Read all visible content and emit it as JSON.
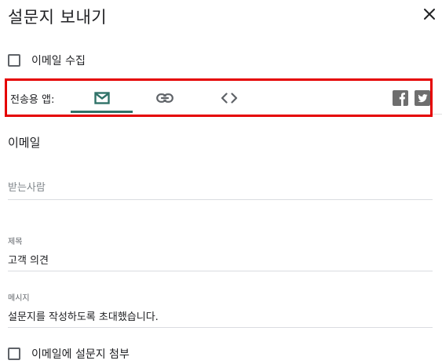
{
  "dialog": {
    "title": "설문지 보내기",
    "close_icon": "close-icon"
  },
  "collect_email": {
    "label": "이메일 수집",
    "checked": false
  },
  "send_via": {
    "label": "전송용 앱:",
    "tabs": [
      {
        "icon": "mail-icon",
        "selected": true
      },
      {
        "icon": "link-icon",
        "selected": false
      },
      {
        "icon": "embed-code-icon",
        "selected": false
      }
    ],
    "social": [
      {
        "icon": "facebook-icon"
      },
      {
        "icon": "twitter-icon"
      }
    ],
    "accent_color": "#2f7268",
    "highlight_color": "#e50000"
  },
  "email_form": {
    "heading": "이메일",
    "to": {
      "value": "",
      "placeholder": "받는사람"
    },
    "subject": {
      "label": "제목",
      "value": "고객 의견"
    },
    "message": {
      "label": "메시지",
      "value": "설문지를 작성하도록 초대했습니다."
    },
    "include_form": {
      "label": "이메일에 설문지 첨부",
      "checked": false
    }
  }
}
